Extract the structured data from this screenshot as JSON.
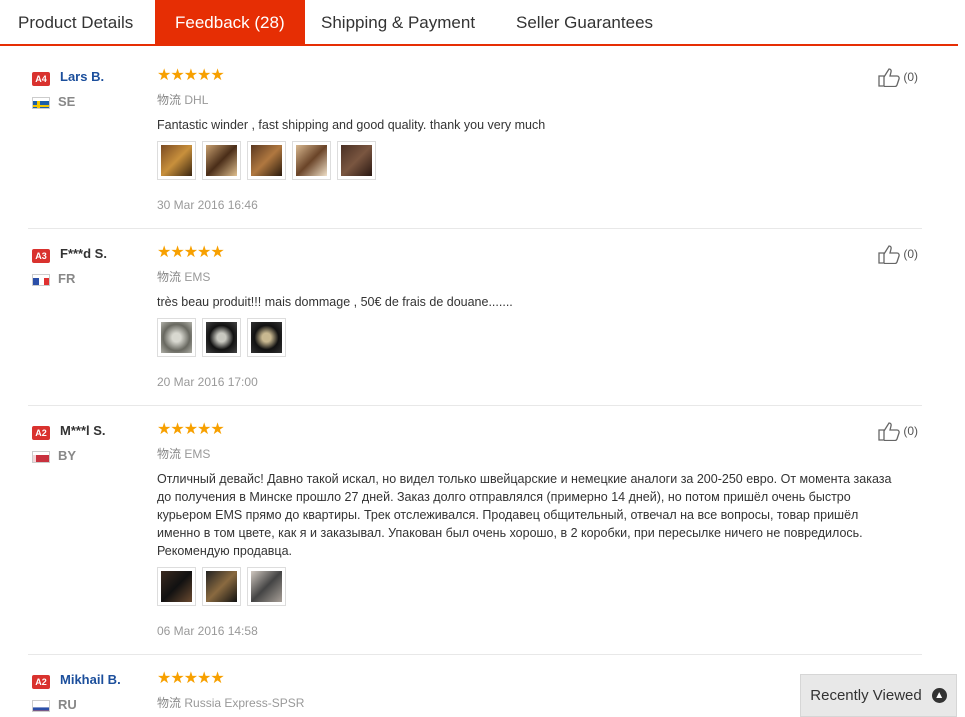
{
  "tabs": [
    {
      "label": "Product Details"
    },
    {
      "label": "Feedback (28)"
    },
    {
      "label": "Shipping & Payment"
    },
    {
      "label": "Seller Guarantees"
    }
  ],
  "reviews": [
    {
      "badge": "A4",
      "name": "Lars B.",
      "country": "SE",
      "shipping_cn": "物流",
      "shipping": "DHL",
      "text": "Fantastic winder , fast shipping and good quality. thank you very much",
      "date": "30 Mar 2016 16:46",
      "helpful": "(0)"
    },
    {
      "badge": "A3",
      "name": "F***d S.",
      "country": "FR",
      "shipping_cn": "物流",
      "shipping": "EMS",
      "text": "très beau produit!!! mais dommage , 50€ de frais de douane.......",
      "date": "20 Mar 2016 17:00",
      "helpful": "(0)"
    },
    {
      "badge": "A2",
      "name": "M***l S.",
      "country": "BY",
      "shipping_cn": "物流",
      "shipping": "EMS",
      "text": "Отличный девайс! Давно такой искал, но видел только швейцарские и немецкие аналоги за 200-250 евро. От момента заказа до получения в Минске прошло 27 дней. Заказ долго отправлялся (примерно 14 дней), но потом пришёл очень быстро курьером EMS прямо до квартиры. Трек отслеживался. Продавец общительный, отвечал на все вопросы, товар пришёл именно в том цвете, как я и заказывал. Упакован был очень хорошо, в 2 коробки, при пересылке ничего не повредилось. Рекомендую продавца.",
      "date": "06 Mar 2016 14:58",
      "helpful": "(0)"
    },
    {
      "badge": "A2",
      "name": "Mikhail B.",
      "country": "RU",
      "shipping_cn": "物流",
      "shipping": "Russia Express-SPSR"
    }
  ],
  "recently_viewed": "Recently Viewed",
  "colors": {
    "accent": "#e62e04",
    "star": "#f7a000",
    "name_link": "#1c4f9c",
    "badge": "#d9322e"
  }
}
